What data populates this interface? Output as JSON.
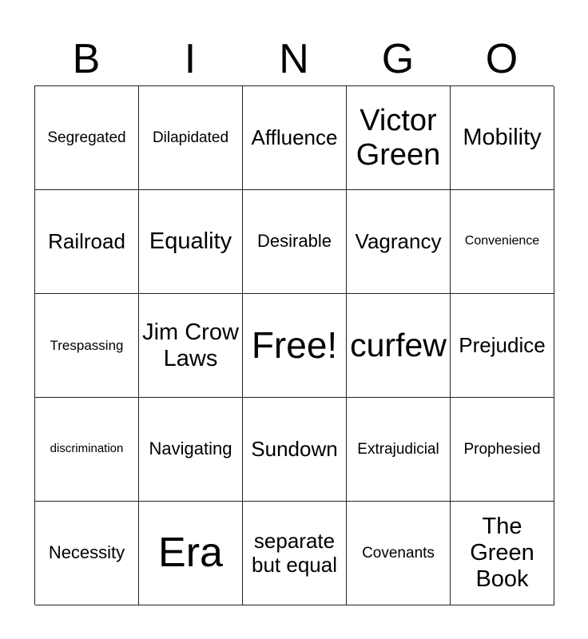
{
  "header": [
    "B",
    "I",
    "N",
    "G",
    "O"
  ],
  "cells": [
    [
      "Segregated",
      "Dilapidated",
      "Affluence",
      "Victor Green",
      "Mobility"
    ],
    [
      "Railroad",
      "Equality",
      "Desirable",
      "Vagrancy",
      "Convenience"
    ],
    [
      "Trespassing",
      "Jim Crow Laws",
      "Free!",
      "curfew",
      "Prejudice"
    ],
    [
      "discrimination",
      "Navigating",
      "Sundown",
      "Extrajudicial",
      "Prophesied"
    ],
    [
      "Necessity",
      "Era",
      "separate but equal",
      "Covenants",
      "The Green Book"
    ]
  ]
}
